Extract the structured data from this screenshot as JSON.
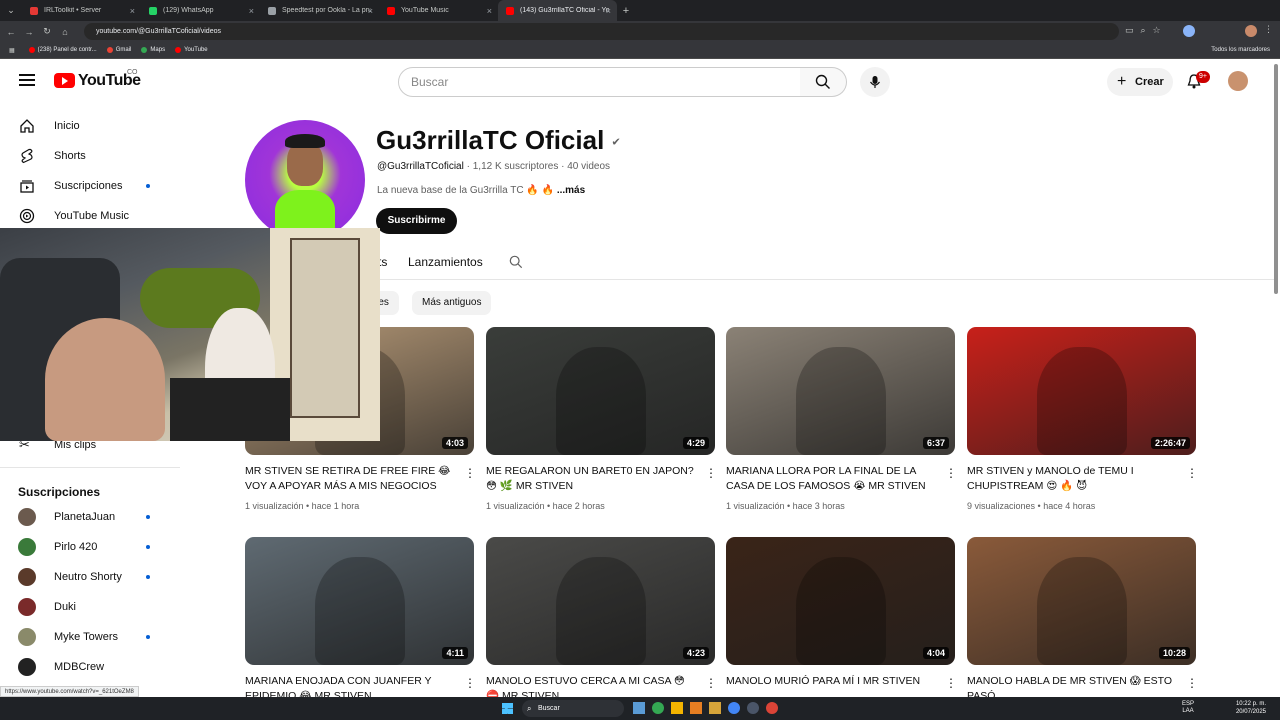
{
  "browser": {
    "tabs": [
      {
        "label": "IRLToolkit • Server",
        "color": "#e53935"
      },
      {
        "label": "(129) WhatsApp",
        "color": "#25d366"
      },
      {
        "label": "Speedtest por Ookla - La pruel",
        "color": "#9aa0a6"
      },
      {
        "label": "YouTube Music",
        "color": "#ff0000"
      },
      {
        "label": "(143) Gu3rrillaTC Oficial - YouTu",
        "color": "#ff0000"
      }
    ],
    "url": "youtube.com/@Gu3rrillaTCoficial/videos",
    "bookmarks": [
      "(238) Panel de contr...",
      "Gmail",
      "Maps",
      "YouTube"
    ],
    "all_bookmarks": "Todos los marcadores",
    "status_url": "https://www.youtube.com/watch?v=_621tOeZM8"
  },
  "header": {
    "logo": "YouTube",
    "country": "CO",
    "search_placeholder": "Buscar",
    "create_label": "Crear",
    "notif_count": "9+"
  },
  "sidebar": {
    "items": [
      {
        "label": "Inicio",
        "icon": "home-icon"
      },
      {
        "label": "Shorts",
        "icon": "shorts-icon"
      },
      {
        "label": "Suscripciones",
        "icon": "subscriptions-icon"
      },
      {
        "label": "YouTube Music",
        "icon": "youtube-music-icon"
      }
    ],
    "clips_label": "Mis clips",
    "subs_heading": "Suscripciones",
    "subscriptions": [
      {
        "label": "PlanetaJuan",
        "dot": true,
        "color": "#6b5a4e"
      },
      {
        "label": "Pirlo 420",
        "dot": true,
        "color": "#3a7a3a"
      },
      {
        "label": "Neutro Shorty",
        "dot": true,
        "color": "#5a3a2a"
      },
      {
        "label": "Duki",
        "dot": false,
        "color": "#7a2a2a"
      },
      {
        "label": "Myke Towers",
        "dot": true,
        "color": "#8a8a6a"
      },
      {
        "label": "MDBCrew",
        "dot": false,
        "color": "#222222"
      }
    ]
  },
  "channel": {
    "name": "Gu3rrillaTC Oficial",
    "handle": "@Gu3rrillaTCoficial",
    "meta": "· 1,12 K suscriptores · 40 videos",
    "description": "La nueva base de la Gu3rrilla TC 🔥 🔥",
    "more": "...más",
    "subscribe": "Suscribirme",
    "tabs": [
      "ts",
      "Lanzamientos"
    ],
    "chips": [
      "res",
      "Más antiguos"
    ]
  },
  "videos": [
    {
      "title": "MR STIVEN SE RETIRA DE FREE FIRE 😂 VOY A APOYAR MÁS A MIS NEGOCIOS",
      "meta": "1 visualización • hace 1 hora",
      "duration": "4:03",
      "bg": "#b79a78"
    },
    {
      "title": "ME REGALARON UN BARET0 EN JAPON?😳 🌿 MR STIVEN",
      "meta": "1 visualización • hace 2 horas",
      "duration": "4:29",
      "bg": "#3a3d3a"
    },
    {
      "title": "MARIANA LLORA POR LA FINAL DE LA CASA DE LOS FAMOSOS 😭 MR STIVEN",
      "meta": "1 visualización • hace 3 horas",
      "duration": "6:37",
      "bg": "#8b8276"
    },
    {
      "title": "MR STIVEN y MANOLO de TEMU I CHUPISTREAM 😍 🔥 😈",
      "meta": "9 visualizaciones • hace 4 horas",
      "duration": "2:26:47",
      "bg": "#c8201a"
    },
    {
      "title": "MARIANA ENOJADA CON JUANFER Y EPIDEMIO 😂 MR STIVEN",
      "meta": "",
      "duration": "4:11",
      "bg": "#5f6a72"
    },
    {
      "title": "MANOLO ESTUVO CERCA A MI CASA 😳 ⛔ MR STIVEN",
      "meta": "",
      "duration": "4:23",
      "bg": "#4a4a48"
    },
    {
      "title": "MANOLO MURIÓ PARA MÍ I MR STIVEN",
      "meta": "",
      "duration": "4:04",
      "bg": "#3a2418"
    },
    {
      "title": "MANOLO HABLA DE MR STIVEN 😱 ESTO PASÓ",
      "meta": "",
      "duration": "10:28",
      "bg": "#8a5a3a"
    }
  ],
  "taskbar": {
    "search": "Buscar",
    "lang": "ESP LAA",
    "time": "10:22 p. m.",
    "date": "20/07/2025"
  }
}
